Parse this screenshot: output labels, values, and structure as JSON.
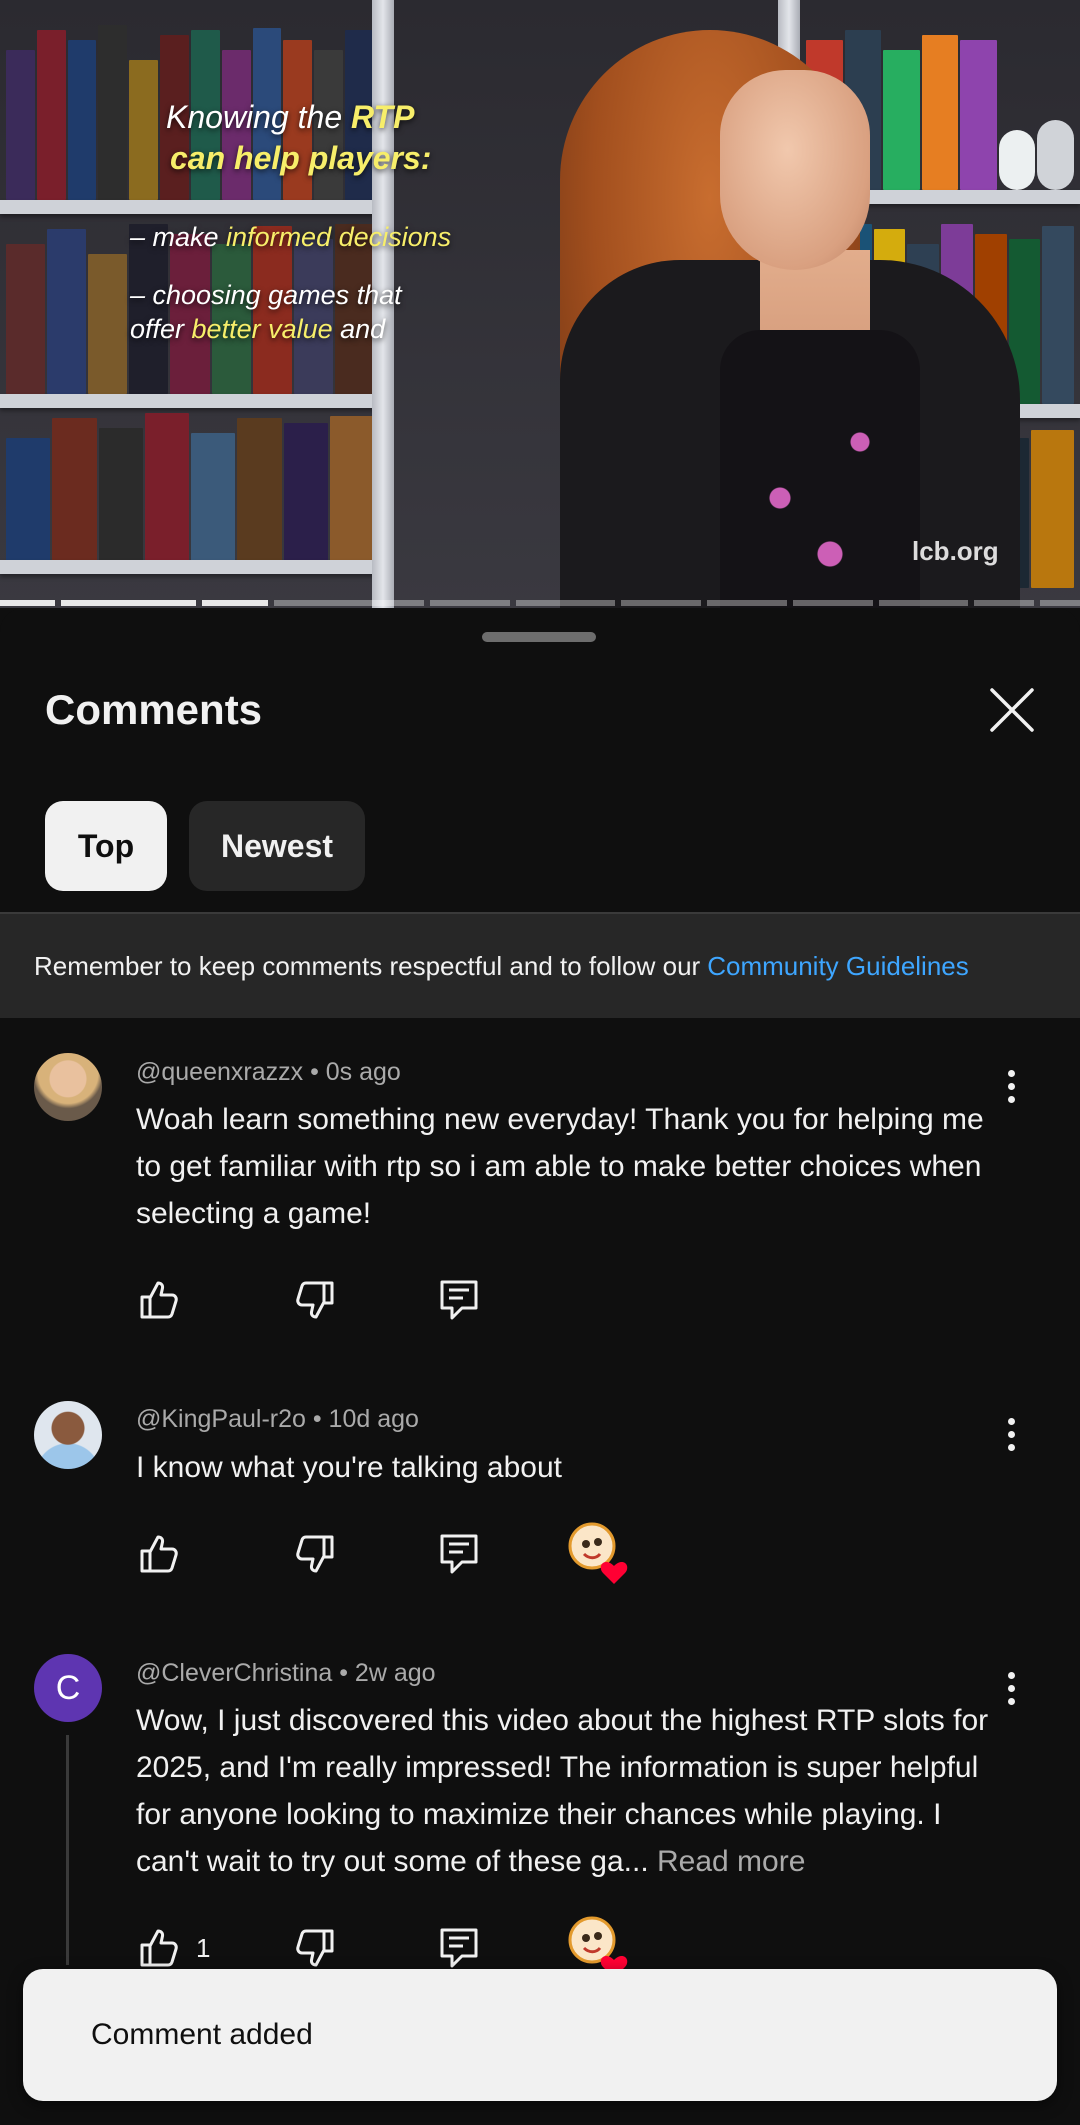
{
  "video": {
    "overlay": {
      "line1_prefix": "Knowing the ",
      "line1_strong": "RTP",
      "line2": "can help players:",
      "bullet1_prefix": "– make ",
      "bullet1_highlight": "informed decisions",
      "bullet2_line1": "– choosing games that",
      "bullet2_prefix": "offer ",
      "bullet2_highlight": "better value",
      "bullet2_suffix": " and"
    },
    "watermark": "lcb.org",
    "progress_segments": 12,
    "progress_played_segments": 3
  },
  "sheet": {
    "title": "Comments",
    "close_icon": "close-icon",
    "tabs": [
      {
        "label": "Top",
        "selected": true
      },
      {
        "label": "Newest",
        "selected": false
      }
    ],
    "guidelines": {
      "text": "Remember to keep comments respectful and to follow our",
      "link": "Community Guidelines"
    }
  },
  "comments": [
    {
      "author": "@queenxrazzx",
      "age": "0s ago",
      "meta": "@queenxrazzx • 0s ago",
      "text": "Woah learn something new everyday! Thank you for helping me to get familiar with rtp so i am able to make better choices when selecting a game!",
      "likes": "",
      "creator_heart": false
    },
    {
      "author": "@KingPaul-r2o",
      "age": "10d ago",
      "meta": "@KingPaul-r2o • 10d ago",
      "text": "I know what you're talking about",
      "likes": "",
      "creator_heart": true
    },
    {
      "author": "@CleverChristina",
      "age": "2w ago",
      "meta": "@CleverChristina • 2w ago",
      "avatar_letter": "C",
      "text": "Wow, I just discovered this video about the highest RTP slots for 2025, and I'm really impressed! The information is super helpful for anyone looking to maximize their chances while playing. I can't wait to try out some of these ga...",
      "read_more": "Read more",
      "likes": "1",
      "creator_heart": true
    }
  ],
  "toast": {
    "message": "Comment added"
  },
  "colors": {
    "background": "#0f0f0f",
    "chip_selected": "#f1f1f1",
    "chip_unselected": "#272727",
    "link": "#3ea6ff",
    "muted_text": "#aaaaaa",
    "heart": "#ff0033",
    "avatar_c": "#5e35b1"
  }
}
